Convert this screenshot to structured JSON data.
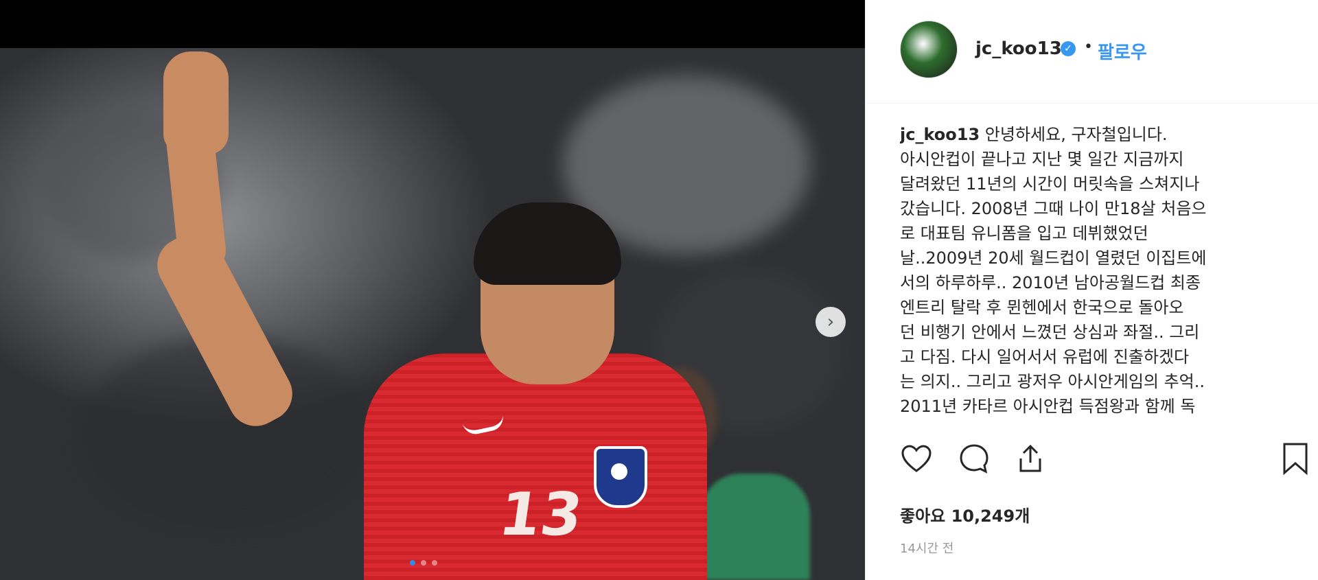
{
  "post": {
    "username": "jc_koo13",
    "follow_label": "팔로우",
    "bullet": "•",
    "caption_lines": [
      "안녕하세요, 구자철입니다.",
      "아시안컵이 끝나고 지난 몇 일간 지금까지",
      "달려왔던 11년의 시간이 머릿속을 스쳐지나",
      "갔습니다. 2008년 그때 나이 만18살 처음으",
      "로 대표팀 유니폼을 입고 데뷔했었던",
      "날..2009년 20세 월드컵이 열렸던 이집트에",
      "서의 하루하루.. 2010년 남아공월드컵 최종",
      "엔트리 탈락 후 뮌헨에서 한국으로 돌아오",
      "던 비행기 안에서 느꼈던 상심과 좌절.. 그리",
      "고 다짐. 다시 일어서서 유럽에 진출하겠다",
      "는 의지.. 그리고 광저우 아시안게임의 추억..",
      "2011년 카타르 아시안컵 득점왕과 함께 독"
    ],
    "likes_text": "좋아요 10,249개",
    "time_text": "14시간 전",
    "jersey_number": "13"
  },
  "icons": {
    "verified": "verified-badge-icon",
    "heart": "heart-icon",
    "comment": "comment-icon",
    "share": "share-icon",
    "bookmark": "bookmark-icon",
    "next": "chevron-right-icon"
  },
  "colors": {
    "accent": "#3897f0",
    "jersey": "#d8232a"
  },
  "carousel": {
    "dot_count": 3,
    "active_index": 0
  }
}
